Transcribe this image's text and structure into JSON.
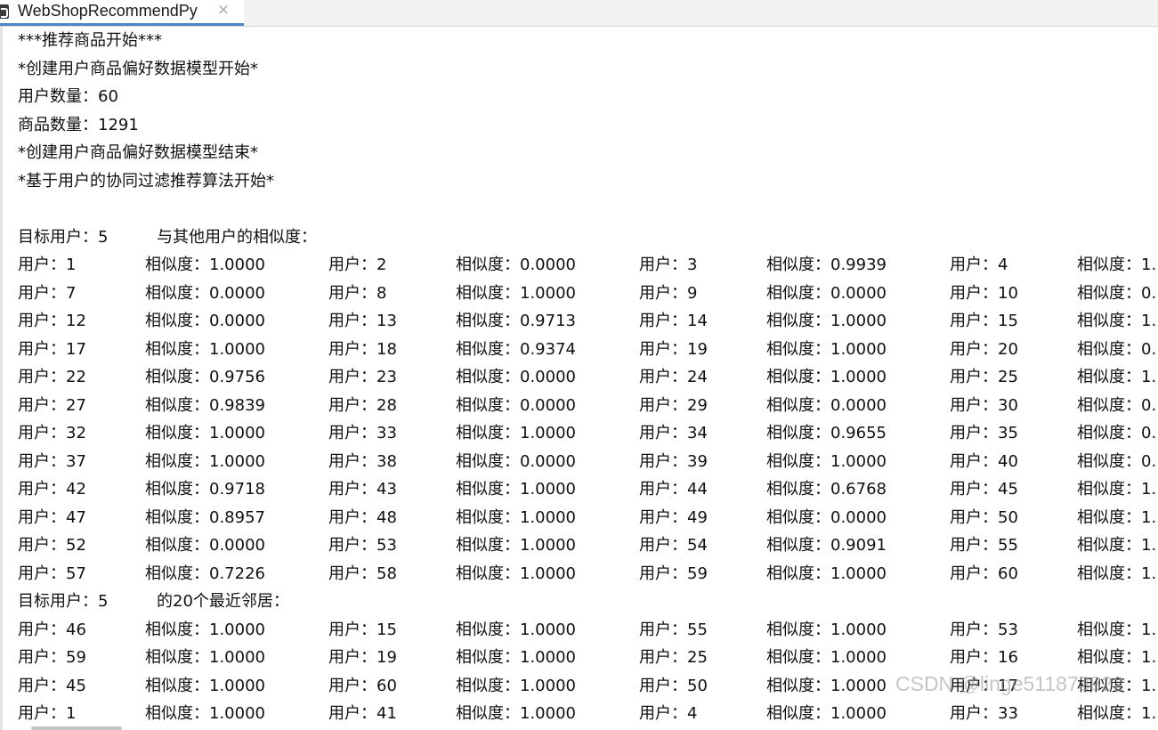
{
  "tab": {
    "title": "WebShopRecommendPy",
    "close_glyph": "×",
    "icon": "python-file-icon"
  },
  "console": {
    "lines": [
      "***推荐商品开始***",
      "*创建用户商品偏好数据模型开始*",
      "用户数量：60",
      "商品数量：1291",
      "*创建用户商品偏好数据模型结束*",
      "*基于用户的协同过滤推荐算法开始*"
    ],
    "similarity_header": {
      "target": "目标用户：5",
      "desc": "与其他用户的相似度："
    },
    "similarity_rows": [
      [
        [
          "用户：1",
          "相似度：1.0000"
        ],
        [
          "用户：2",
          "相似度：0.0000"
        ],
        [
          "用户：3",
          "相似度：0.9939"
        ],
        [
          "用户：4",
          "相似度：1."
        ]
      ],
      [
        [
          "用户：7",
          "相似度：0.0000"
        ],
        [
          "用户：8",
          "相似度：1.0000"
        ],
        [
          "用户：9",
          "相似度：0.0000"
        ],
        [
          "用户：10",
          "相似度：0."
        ]
      ],
      [
        [
          "用户：12",
          "相似度：0.0000"
        ],
        [
          "用户：13",
          "相似度：0.9713"
        ],
        [
          "用户：14",
          "相似度：1.0000"
        ],
        [
          "用户：15",
          "相似度：1."
        ]
      ],
      [
        [
          "用户：17",
          "相似度：1.0000"
        ],
        [
          "用户：18",
          "相似度：0.9374"
        ],
        [
          "用户：19",
          "相似度：1.0000"
        ],
        [
          "用户：20",
          "相似度：0."
        ]
      ],
      [
        [
          "用户：22",
          "相似度：0.9756"
        ],
        [
          "用户：23",
          "相似度：0.0000"
        ],
        [
          "用户：24",
          "相似度：1.0000"
        ],
        [
          "用户：25",
          "相似度：1."
        ]
      ],
      [
        [
          "用户：27",
          "相似度：0.9839"
        ],
        [
          "用户：28",
          "相似度：0.0000"
        ],
        [
          "用户：29",
          "相似度：0.0000"
        ],
        [
          "用户：30",
          "相似度：0."
        ]
      ],
      [
        [
          "用户：32",
          "相似度：1.0000"
        ],
        [
          "用户：33",
          "相似度：1.0000"
        ],
        [
          "用户：34",
          "相似度：0.9655"
        ],
        [
          "用户：35",
          "相似度：0."
        ]
      ],
      [
        [
          "用户：37",
          "相似度：1.0000"
        ],
        [
          "用户：38",
          "相似度：0.0000"
        ],
        [
          "用户：39",
          "相似度：1.0000"
        ],
        [
          "用户：40",
          "相似度：0."
        ]
      ],
      [
        [
          "用户：42",
          "相似度：0.9718"
        ],
        [
          "用户：43",
          "相似度：1.0000"
        ],
        [
          "用户：44",
          "相似度：0.6768"
        ],
        [
          "用户：45",
          "相似度：1."
        ]
      ],
      [
        [
          "用户：47",
          "相似度：0.8957"
        ],
        [
          "用户：48",
          "相似度：1.0000"
        ],
        [
          "用户：49",
          "相似度：0.0000"
        ],
        [
          "用户：50",
          "相似度：1."
        ]
      ],
      [
        [
          "用户：52",
          "相似度：0.0000"
        ],
        [
          "用户：53",
          "相似度：1.0000"
        ],
        [
          "用户：54",
          "相似度：0.9091"
        ],
        [
          "用户：55",
          "相似度：1."
        ]
      ],
      [
        [
          "用户：57",
          "相似度：0.7226"
        ],
        [
          "用户：58",
          "相似度：1.0000"
        ],
        [
          "用户：59",
          "相似度：1.0000"
        ],
        [
          "用户：60",
          "相似度：1."
        ]
      ]
    ],
    "neighbors_header": {
      "target": "目标用户：5",
      "desc": "的20个最近邻居："
    },
    "neighbor_rows": [
      [
        [
          "用户：46",
          "相似度：1.0000"
        ],
        [
          "用户：15",
          "相似度：1.0000"
        ],
        [
          "用户：55",
          "相似度：1.0000"
        ],
        [
          "用户：53",
          "相似度：1."
        ]
      ],
      [
        [
          "用户：59",
          "相似度：1.0000"
        ],
        [
          "用户：19",
          "相似度：1.0000"
        ],
        [
          "用户：25",
          "相似度：1.0000"
        ],
        [
          "用户：16",
          "相似度：1."
        ]
      ],
      [
        [
          "用户：45",
          "相似度：1.0000"
        ],
        [
          "用户：60",
          "相似度：1.0000"
        ],
        [
          "用户：50",
          "相似度：1.0000"
        ],
        [
          "用户：17",
          "相似度：1."
        ]
      ],
      [
        [
          "用户：1",
          "相似度：1.0000"
        ],
        [
          "用户：41",
          "相似度：1.0000"
        ],
        [
          "用户：4",
          "相似度：1.0000"
        ],
        [
          "用户：33",
          "相似度：1."
        ]
      ]
    ]
  },
  "watermark": "CSDN @linge511873822"
}
